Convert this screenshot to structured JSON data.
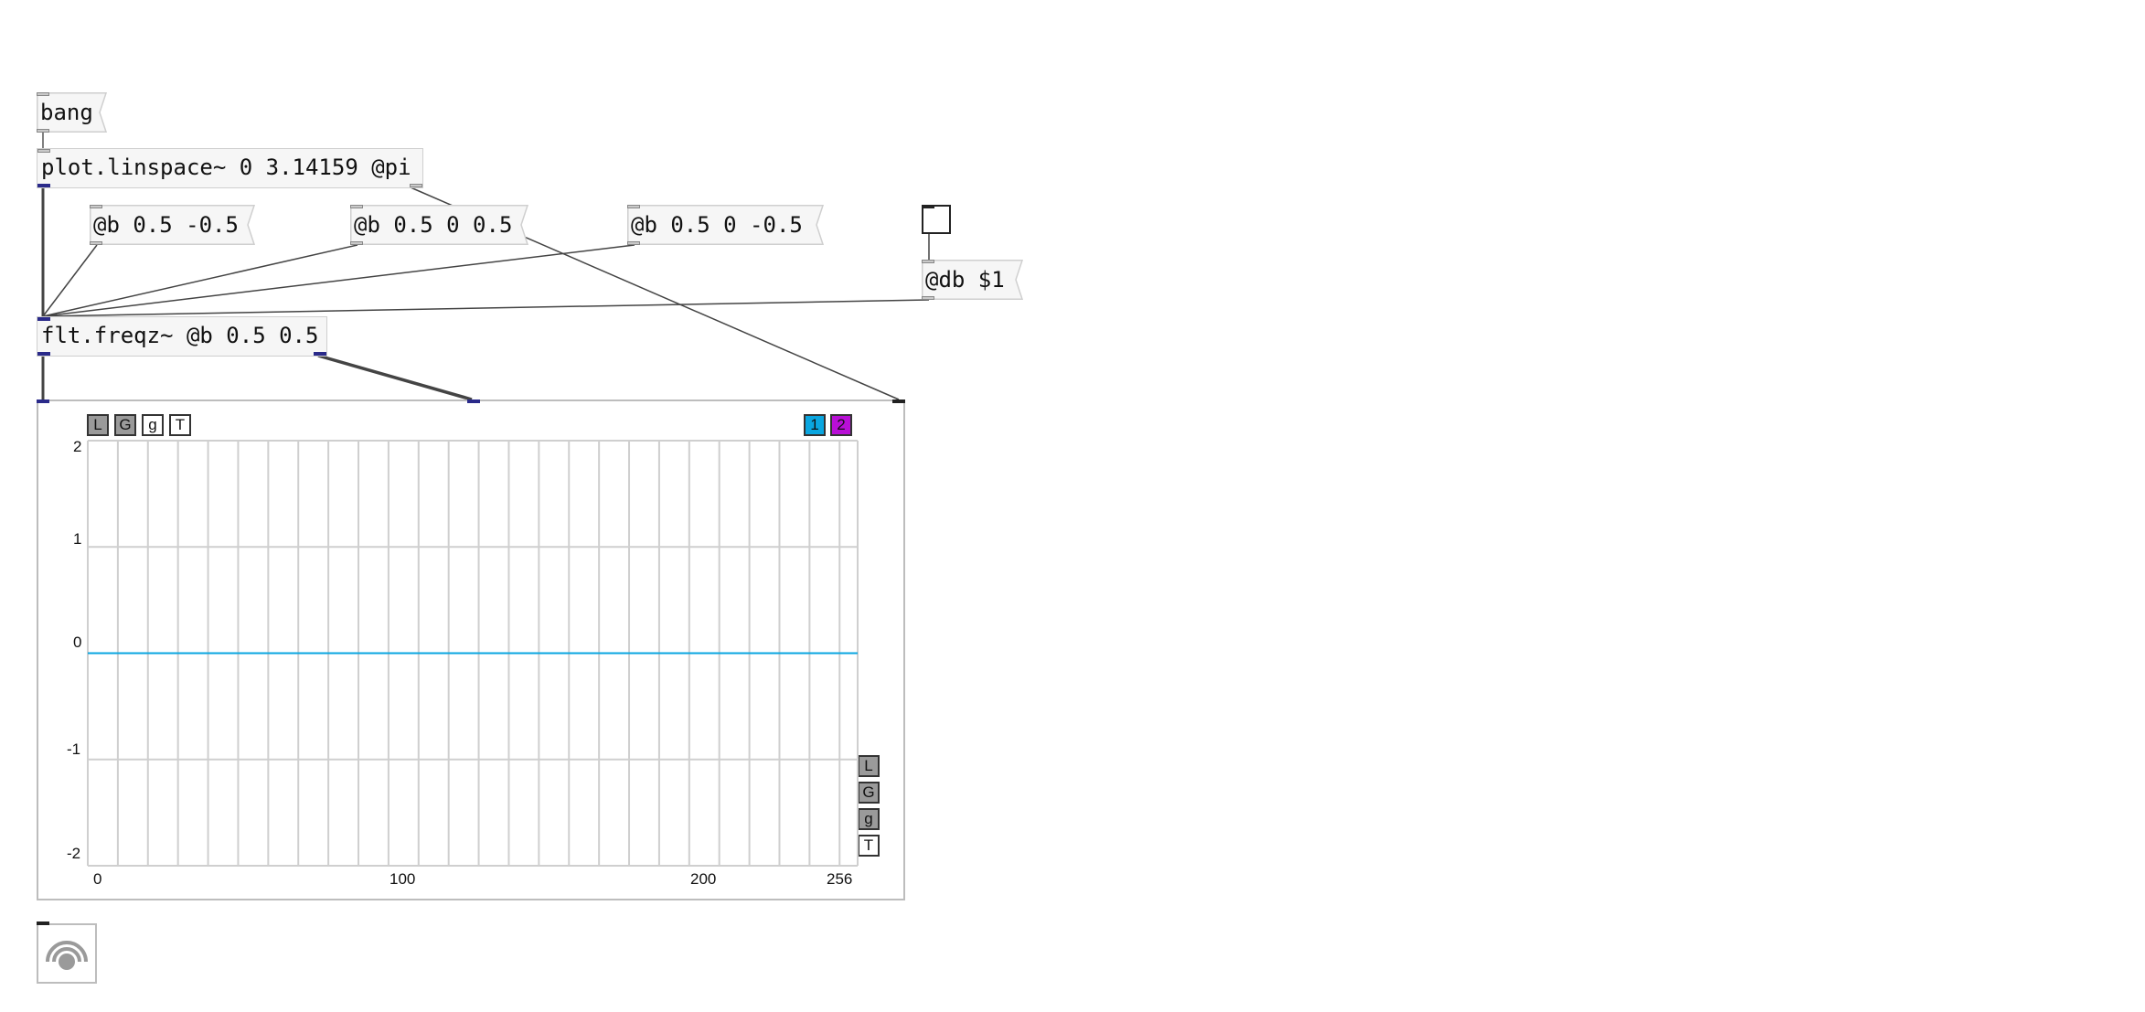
{
  "patch": {
    "bang_msg": "bang",
    "linspace_obj": "plot.linspace~ 0 3.14159 @pi",
    "coef_msgs": [
      "@b 0.5 -0.5",
      "@b 0.5 0 0.5",
      "@b 0.5 0 -0.5"
    ],
    "db_msg": "@db $1",
    "freqz_obj": "flt.freqz~ @b 0.5 0.5"
  },
  "plot": {
    "toolbar_top": [
      "L",
      "G",
      "g",
      "T"
    ],
    "channel_buttons": [
      "1",
      "2"
    ],
    "toolbar_side": [
      "L",
      "G",
      "g",
      "T"
    ],
    "y_ticks": [
      "2",
      "1",
      "0",
      "-1",
      "-2"
    ],
    "x_ticks": [
      "0",
      "100",
      "200",
      "256"
    ],
    "colors": {
      "channel1": "#0aa6e0",
      "channel2": "#b80fd6",
      "grid": "#cfcfcf"
    }
  },
  "chart_data": {
    "type": "line",
    "x": [
      0,
      256
    ],
    "series": [
      {
        "values": [
          0,
          0
        ]
      }
    ],
    "xlim": [
      0,
      256
    ],
    "ylim": [
      -2,
      2
    ],
    "grid": true,
    "xticks": [
      0,
      100,
      200,
      256
    ],
    "yticks": [
      -2,
      -1,
      0,
      1,
      2
    ]
  }
}
